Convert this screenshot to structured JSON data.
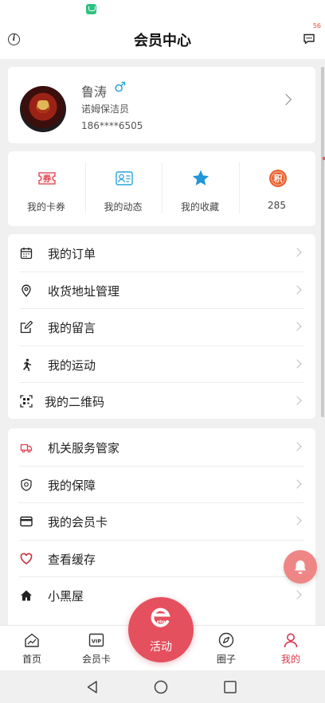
{
  "status_bar": {
    "app_icon": "mi-home-icon"
  },
  "header": {
    "title": "会员中心",
    "info_icon": "info-icon",
    "message_icon": "message-icon",
    "message_badge": "56"
  },
  "profile": {
    "name": "鲁涛",
    "gender_symbol": "♂",
    "role": "诺姆保洁员",
    "phone": "186****6505",
    "avatar_icon": "avatar-image"
  },
  "quick_actions": [
    {
      "label": "我的卡券",
      "icon": "coupon-icon",
      "color": "#e0414f"
    },
    {
      "label": "我的动态",
      "icon": "profile-card-icon",
      "color": "#2aa3d8"
    },
    {
      "label": "我的收藏",
      "icon": "star-icon",
      "color": "#2196d8"
    },
    {
      "label": "285",
      "icon": "points-icon",
      "color": "#e8622e"
    }
  ],
  "menu_group_1": [
    {
      "label": "我的订单",
      "icon": "calendar-icon"
    },
    {
      "label": "收货地址管理",
      "icon": "location-icon"
    },
    {
      "label": "我的留言",
      "icon": "edit-icon"
    },
    {
      "label": "我的运动",
      "icon": "running-icon"
    },
    {
      "label": "我的二维码",
      "icon": "qr-code-icon"
    }
  ],
  "menu_group_2": [
    {
      "label": "机关服务管家",
      "icon": "service-truck-icon"
    },
    {
      "label": "我的保障",
      "icon": "shield-icon"
    },
    {
      "label": "我的会员卡",
      "icon": "card-icon"
    },
    {
      "label": "查看缓存",
      "icon": "heart-icon"
    },
    {
      "label": "小黑屋",
      "icon": "home-icon"
    }
  ],
  "tabs": [
    {
      "label": "首页",
      "icon": "home-chart-icon",
      "active": false
    },
    {
      "label": "会员卡",
      "icon": "vip-icon",
      "active": false
    },
    {
      "label": "圈子",
      "icon": "compass-icon",
      "active": false
    },
    {
      "label": "我的",
      "icon": "user-icon",
      "active": true
    }
  ],
  "center_tab": {
    "label": "活动",
    "logo_text": "ebo"
  },
  "colors": {
    "accent": "#d9364a",
    "center_button": "#e5505e",
    "float_button": "#ef8686"
  }
}
